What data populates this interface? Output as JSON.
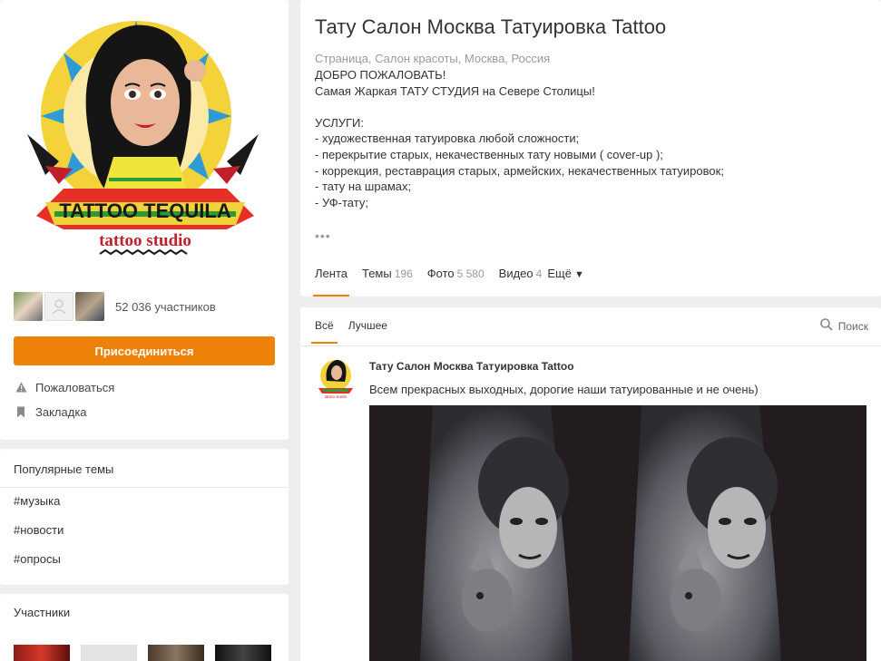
{
  "profile": {
    "logo_alt": "TATTOO TEQUILA tattoo studio",
    "members_count": "52 036 участников",
    "join_label": "Присоединиться",
    "actions": [
      {
        "icon": "warning-icon",
        "label": "Пожаловаться"
      },
      {
        "icon": "bookmark-icon",
        "label": "Закладка"
      }
    ]
  },
  "popular": {
    "title": "Популярные темы",
    "topics": [
      "#музыка",
      "#новости",
      "#опросы"
    ]
  },
  "participants": {
    "title": "Участники"
  },
  "group": {
    "title": "Тату Салон Москва Татуировка Tattoo",
    "subtitle": "Страница, Салон красоты, Москва, Россия",
    "description": [
      "ДОБРО ПОЖАЛОВАТЬ!",
      "Самая Жаркая ТАТУ СТУДИЯ на Севере Столицы!",
      "",
      "УСЛУГИ:",
      "- художественная татуировка любой сложности;",
      "- перекрытие старых, некачественных тату новыми ( cover-up );",
      "- коррекция, реставрация старых, армейских, некачественных татуировок;",
      "- тату на шрамах;",
      "- УФ-тату;"
    ],
    "more": "•••",
    "tabs": [
      {
        "label": "Лента",
        "count": ""
      },
      {
        "label": "Темы",
        "count": "196"
      },
      {
        "label": "Фото",
        "count": "5 580"
      },
      {
        "label": "Видео",
        "count": "4"
      },
      {
        "label": "Ещё",
        "count": ""
      }
    ]
  },
  "feed": {
    "tabs": [
      "Всё",
      "Лучшее"
    ],
    "search_label": "Поиск",
    "post": {
      "author": "Тату Салон Москва Татуировка Tattoo",
      "text": "Всем прекрасных выходных, дорогие наши татуированные и не очень)"
    }
  },
  "colors": {
    "accent": "#ee8208",
    "background": "#eeeeee"
  }
}
